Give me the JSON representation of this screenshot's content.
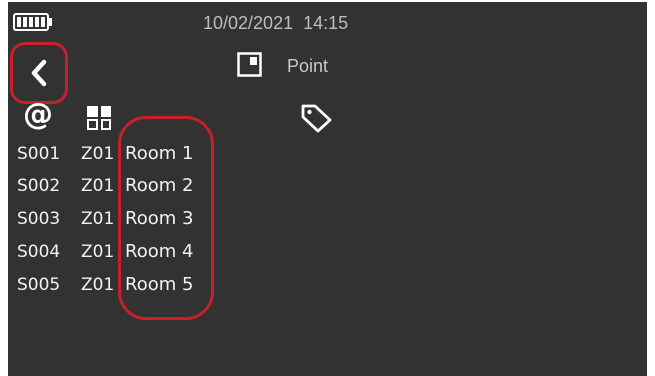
{
  "status_bar": {
    "date": "10/02/2021",
    "time": "14:15"
  },
  "header": {
    "title": "Point",
    "point_icon": "square-corner-icon",
    "back_icon": "chevron-left-icon"
  },
  "columns": {
    "address_icon": "at-icon",
    "zone_icon": "grid-icon",
    "tag_icon": "tag-icon"
  },
  "rows": [
    {
      "id": "S001",
      "zone": "Z01",
      "room": "Room 1"
    },
    {
      "id": "S002",
      "zone": "Z01",
      "room": "Room 2"
    },
    {
      "id": "S003",
      "zone": "Z01",
      "room": "Room 3"
    },
    {
      "id": "S004",
      "zone": "Z01",
      "room": "Room 4"
    },
    {
      "id": "S005",
      "zone": "Z01",
      "room": "Room 5"
    }
  ],
  "colors": {
    "background": "#323232",
    "highlight": "#c8202a",
    "text": "#f2f2f2"
  }
}
